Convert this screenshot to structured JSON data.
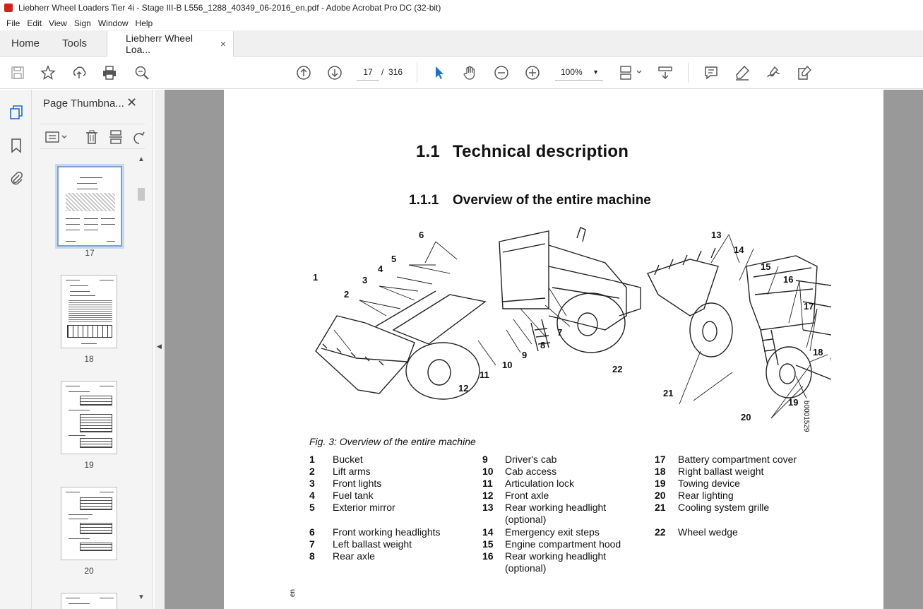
{
  "window": {
    "title": "Liebherr Wheel Loaders Tier 4i - Stage III-B L556_1288_40349_06-2016_en.pdf - Adobe Acrobat Pro DC (32-bit)"
  },
  "menu": [
    "File",
    "Edit",
    "View",
    "Sign",
    "Window",
    "Help"
  ],
  "tabs": {
    "home": "Home",
    "tools": "Tools",
    "document": "Liebherr Wheel Loa...",
    "close": "×"
  },
  "toolbar": {
    "current_page": "17",
    "page_separator": "/",
    "total_pages": "316",
    "zoom": "100%",
    "icons": [
      "save-icon",
      "star-icon",
      "share-icon",
      "print-icon",
      "find-icon",
      "page-up-icon",
      "page-down-icon",
      "select-cursor-icon",
      "hand-icon",
      "zoom-out-icon",
      "zoom-in-icon",
      "page-fit-icon",
      "scroll-mode-icon",
      "comment-icon",
      "highlight-icon",
      "sign-icon",
      "fill-sign-icon"
    ]
  },
  "panel": {
    "title": "Page Thumbna...",
    "close": "✕",
    "thumbnails": [
      {
        "label": "17",
        "selected": true
      },
      {
        "label": "18",
        "selected": false
      },
      {
        "label": "19",
        "selected": false
      },
      {
        "label": "20",
        "selected": false
      }
    ]
  },
  "document": {
    "section_num": "1.1",
    "section_title": "Technical description",
    "subsection_num": "1.1.1",
    "subsection_title": "Overview of the entire machine",
    "figure_code": "b000152​9",
    "caption": "Fig. 3: Overview of the entire machine",
    "callouts": [
      "1",
      "2",
      "3",
      "4",
      "5",
      "6",
      "7",
      "8",
      "9",
      "10",
      "11",
      "12",
      "13",
      "14",
      "15",
      "16",
      "17",
      "18",
      "19",
      "20",
      "21",
      "22"
    ],
    "legend": {
      "col1": [
        {
          "n": "1",
          "t": "Bucket"
        },
        {
          "n": "2",
          "t": "Lift arms"
        },
        {
          "n": "3",
          "t": "Front lights"
        },
        {
          "n": "4",
          "t": "Fuel tank"
        },
        {
          "n": "5",
          "t": "Exterior mirror"
        },
        {
          "n": "6",
          "t": "Front working headlights"
        },
        {
          "n": "7",
          "t": "Left ballast weight"
        },
        {
          "n": "8",
          "t": "Rear axle"
        }
      ],
      "col2": [
        {
          "n": "9",
          "t": "Driver's cab"
        },
        {
          "n": "10",
          "t": "Cab access"
        },
        {
          "n": "11",
          "t": "Articulation lock"
        },
        {
          "n": "12",
          "t": "Front axle"
        },
        {
          "n": "13",
          "t": "Rear working headlight"
        },
        {
          "n": "13b",
          "t": "(optional)"
        },
        {
          "n": "14",
          "t": "Emergency exit steps"
        },
        {
          "n": "15",
          "t": "Engine compartment hood"
        },
        {
          "n": "16",
          "t": "Rear working headlight"
        },
        {
          "n": "16b",
          "t": "(optional)"
        }
      ],
      "col3": [
        {
          "n": "17",
          "t": "Battery compartment cover"
        },
        {
          "n": "18",
          "t": "Right ballast weight"
        },
        {
          "n": "19",
          "t": "Towing device"
        },
        {
          "n": "20",
          "t": "Rear lighting"
        },
        {
          "n": "21",
          "t": "Cooling system grille"
        },
        {
          "n": "22",
          "t": "Wheel wedge"
        }
      ]
    },
    "margin_text": "en"
  }
}
